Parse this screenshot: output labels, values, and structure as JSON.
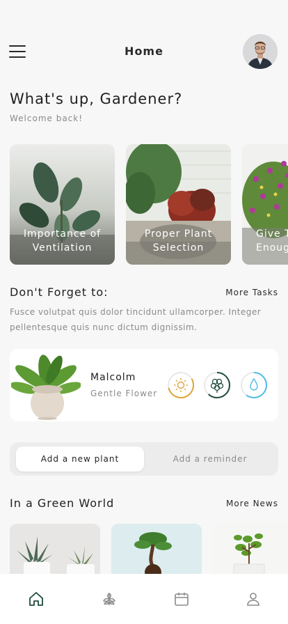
{
  "header": {
    "title": "Home"
  },
  "greeting": {
    "title": "What's up, Gardener?",
    "subtitle": "Welcome back!"
  },
  "featured_cards": [
    {
      "label": "Importance of\nVentilation"
    },
    {
      "label": "Proper Plant\nSelection"
    },
    {
      "label": "Give T\nEnoug"
    }
  ],
  "tasks": {
    "title": "Don't Forget to:",
    "more_label": "More Tasks",
    "description": "Fusce volutpat quis dolor tincidunt ullamcorper. Integer pellentesque quis nunc dictum dignissim."
  },
  "plant": {
    "name": "Malcolm",
    "type": "Gentle Flower",
    "rings": [
      {
        "icon": "sun-icon",
        "color": "#e0a33a",
        "progress": 0.55
      },
      {
        "icon": "fertilizer-icon",
        "color": "#1f4a3a",
        "progress": 0.62
      },
      {
        "icon": "water-drop-icon",
        "color": "#4fbde6",
        "progress": 0.6
      }
    ]
  },
  "actions": {
    "add_plant": "Add a new plant",
    "add_reminder": "Add a reminder"
  },
  "news": {
    "title": "In a Green World",
    "more_label": "More News"
  },
  "nav": [
    {
      "icon": "home-icon",
      "active": true
    },
    {
      "icon": "leaf-icon",
      "active": false
    },
    {
      "icon": "calendar-icon",
      "active": false
    },
    {
      "icon": "profile-icon",
      "active": false
    }
  ],
  "colors": {
    "accent": "#1f4a3a",
    "background": "#f7f7f7"
  }
}
